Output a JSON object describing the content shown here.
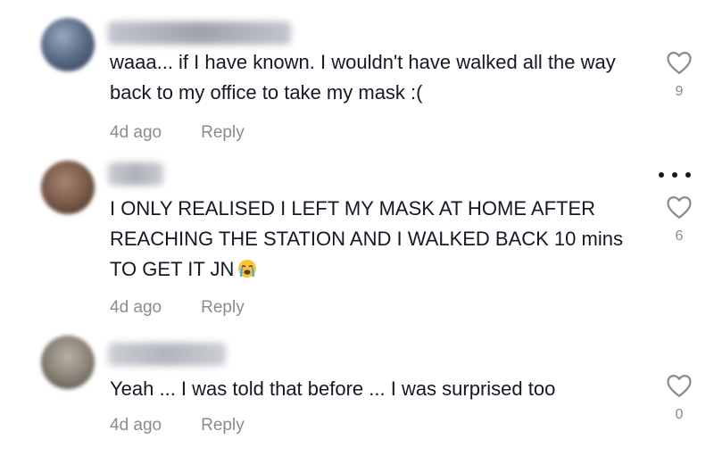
{
  "comments": [
    {
      "text": "waaa... if I have known. I wouldn't have walked all the way back to my office to take my mask :(",
      "time": "4d ago",
      "reply_label": "Reply",
      "likes": "9",
      "avatar_color": "#5d6f8a",
      "username_color": "#9fa2ad"
    },
    {
      "text": "I ONLY REALISED I LEFT MY MASK AT HOME AFTER REACHING THE STATION AND I WALKED BACK 10 mins TO GET IT JN",
      "emoji": "loudly-crying-face",
      "time": "4d ago",
      "reply_label": "Reply",
      "likes": "6",
      "avatar_color": "#7a5b4a",
      "username_color": "#a9abb3"
    },
    {
      "text": "Yeah ... I was told that before ... I was surprised too",
      "time": "4d ago",
      "reply_label": "Reply",
      "likes": "0",
      "avatar_color": "#8b8479",
      "username_color": "#aeb0b8"
    }
  ],
  "icons": {
    "like": "heart-outline-icon",
    "more": "more-options-icon"
  }
}
